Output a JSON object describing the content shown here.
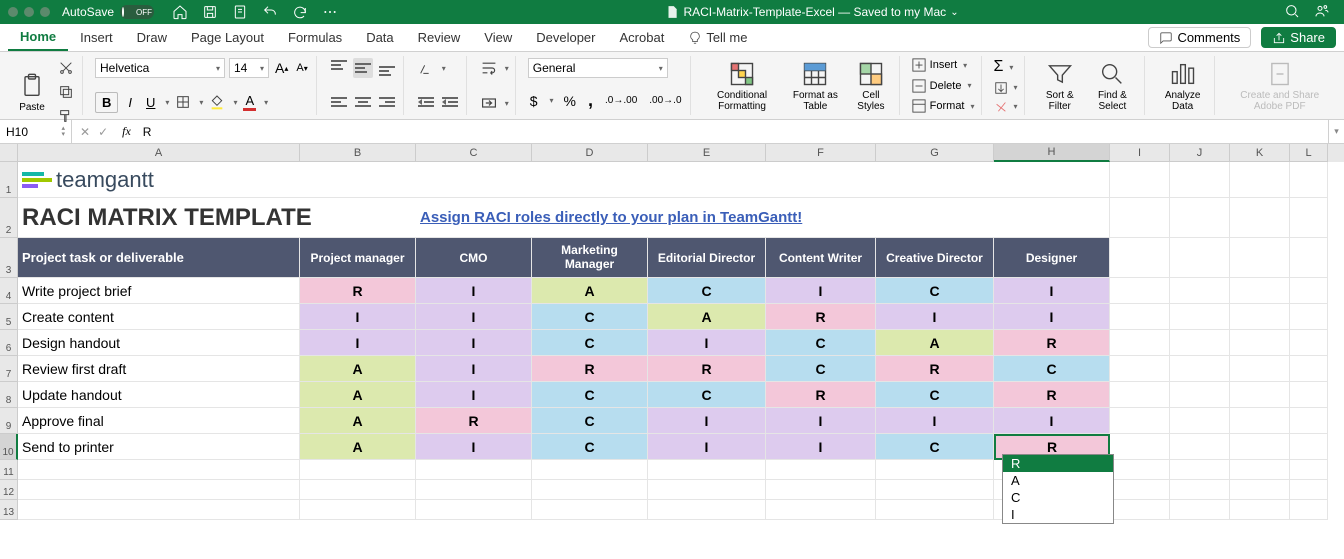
{
  "titlebar": {
    "autosave_label": "AutoSave",
    "autosave_state": "OFF",
    "doc_title": "RACI-Matrix-Template-Excel — Saved to my Mac"
  },
  "tabs": {
    "items": [
      "Home",
      "Insert",
      "Draw",
      "Page Layout",
      "Formulas",
      "Data",
      "Review",
      "View",
      "Developer",
      "Acrobat",
      "Tell me"
    ],
    "active": 0,
    "comments": "Comments",
    "share": "Share"
  },
  "ribbon": {
    "paste": "Paste",
    "font_name": "Helvetica",
    "font_size": "14",
    "number_format": "General",
    "cond_fmt": "Conditional Formatting",
    "fmt_table": "Format as Table",
    "cell_styles": "Cell Styles",
    "insert": "Insert",
    "delete": "Delete",
    "format": "Format",
    "sort_filter": "Sort & Filter",
    "find_select": "Find & Select",
    "analyze": "Analyze Data",
    "adobe": "Create and Share Adobe PDF"
  },
  "namebox": {
    "cell": "H10",
    "formula": "R"
  },
  "columns": [
    "A",
    "B",
    "C",
    "D",
    "E",
    "F",
    "G",
    "H",
    "I",
    "J",
    "K",
    "L"
  ],
  "row_numbers": [
    "1",
    "2",
    "3",
    "4",
    "5",
    "6",
    "7",
    "8",
    "9",
    "10",
    "11",
    "12",
    "13"
  ],
  "content": {
    "logo_text": "teamgantt",
    "title": "RACI MATRIX TEMPLATE",
    "link": "Assign RACI roles directly to your plan in TeamGantt!"
  },
  "headers": [
    "Project task or deliverable",
    "Project manager",
    "CMO",
    "Marketing Manager",
    "Editorial Director",
    "Content Writer",
    "Creative Director",
    "Designer"
  ],
  "rows": [
    {
      "task": "Write project brief",
      "v": [
        "R",
        "I",
        "A",
        "C",
        "I",
        "C",
        "I"
      ]
    },
    {
      "task": "Create content",
      "v": [
        "I",
        "I",
        "C",
        "A",
        "R",
        "I",
        "I"
      ]
    },
    {
      "task": "Design handout",
      "v": [
        "I",
        "I",
        "C",
        "I",
        "C",
        "A",
        "R"
      ]
    },
    {
      "task": "Review first draft",
      "v": [
        "A",
        "I",
        "R",
        "R",
        "C",
        "R",
        "C"
      ]
    },
    {
      "task": "Update handout",
      "v": [
        "A",
        "I",
        "C",
        "C",
        "R",
        "C",
        "R"
      ]
    },
    {
      "task": "Approve final",
      "v": [
        "A",
        "R",
        "C",
        "I",
        "I",
        "I",
        "I"
      ]
    },
    {
      "task": "Send to printer",
      "v": [
        "A",
        "I",
        "C",
        "I",
        "I",
        "C",
        "R"
      ]
    }
  ],
  "dropdown": {
    "options": [
      "R",
      "A",
      "C",
      "I"
    ],
    "selected": "R"
  }
}
